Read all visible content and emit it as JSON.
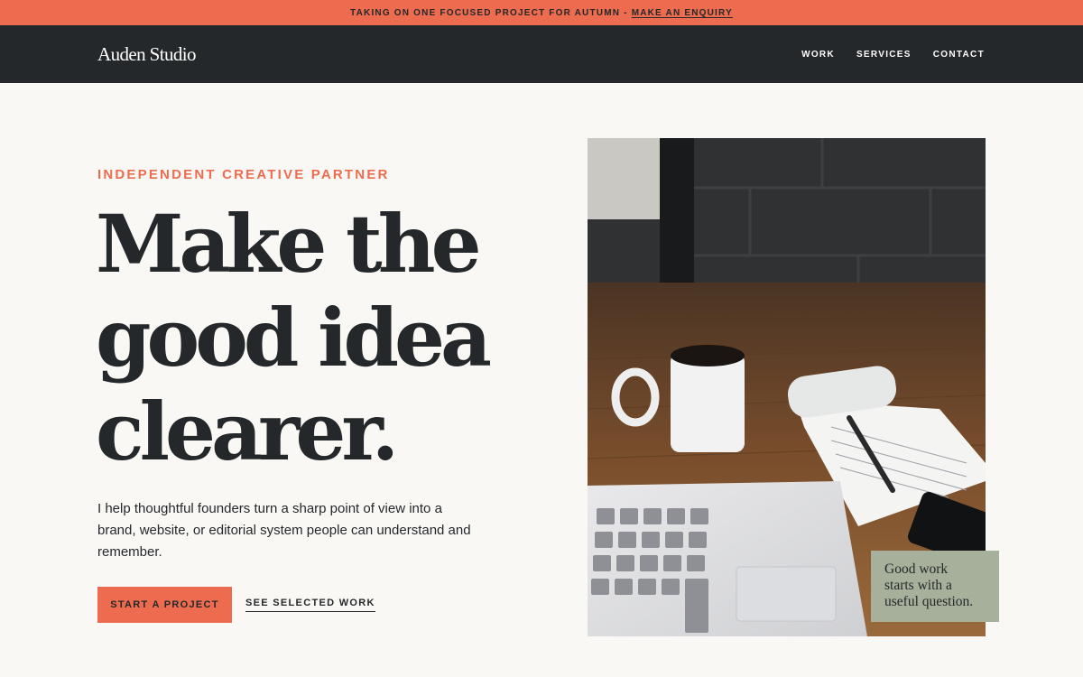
{
  "announcement": {
    "text": "TAKING ON ONE FOCUSED PROJECT FOR AUTUMN",
    "separator": "-",
    "link_label": "MAKE AN ENQUIRY"
  },
  "header": {
    "brand": "Auden Studio",
    "nav": [
      "WORK",
      "SERVICES",
      "CONTACT"
    ]
  },
  "hero": {
    "eyebrow": "INDEPENDENT CREATIVE PARTNER",
    "headline_lines": [
      "Make the",
      "good idea",
      "clearer."
    ],
    "lede": "I help thoughtful founders turn a sharp point of view into a brand, website, or editorial system people can understand and remember.",
    "primary_cta": "START A PROJECT",
    "secondary_cta": "SEE SELECTED WORK"
  },
  "quote_card": {
    "lines": [
      "Good work",
      "starts with a",
      "useful question."
    ]
  },
  "colors": {
    "accent": "#ed6c4f",
    "dark": "#24282b",
    "background": "#faf8f5",
    "sage": "#a7b09b"
  }
}
